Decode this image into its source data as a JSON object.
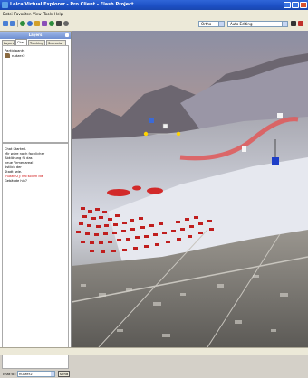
{
  "window": {
    "title": "Leica Virtual Explorer - Pro Client - Flash Project",
    "accent": "#1c4fc4"
  },
  "menu": [
    "Datei",
    "Favoriten",
    "View",
    "Tools",
    "Help"
  ],
  "toolbar": {
    "layer_dropdown": "Ortho",
    "mode_dropdown": "Auto Editing"
  },
  "panel": {
    "title": "Layers",
    "tabs": [
      "Layers",
      "Chat",
      "Tracking",
      "Scenario"
    ],
    "active_tab": "Chat",
    "participants_label": "Participants",
    "participants": [
      {
        "name": "nutzer2",
        "icon": "user-group-icon"
      }
    ]
  },
  "chat": {
    "lines": [
      {
        "text": "Chat Started.",
        "color": "#000000"
      },
      {
        "text": "Mir wäre nach fachlicher",
        "color": "#000000"
      },
      {
        "text": "Abklärung fü das",
        "color": "#000000"
      },
      {
        "text": "neue Firmenareal",
        "color": "#000000"
      },
      {
        "text": "östlich der",
        "color": "#000000"
      },
      {
        "text": "Stadt, wie.",
        "color": "#000000"
      },
      {
        "text": "[nutzer2]: Wo sollen die",
        "color": "#cc0000"
      },
      {
        "text": "Gebäude hin?",
        "color": "#000000"
      }
    ],
    "recipient_label": "chat to:",
    "recipient_value": "nutzer2",
    "send_label": "Send"
  }
}
